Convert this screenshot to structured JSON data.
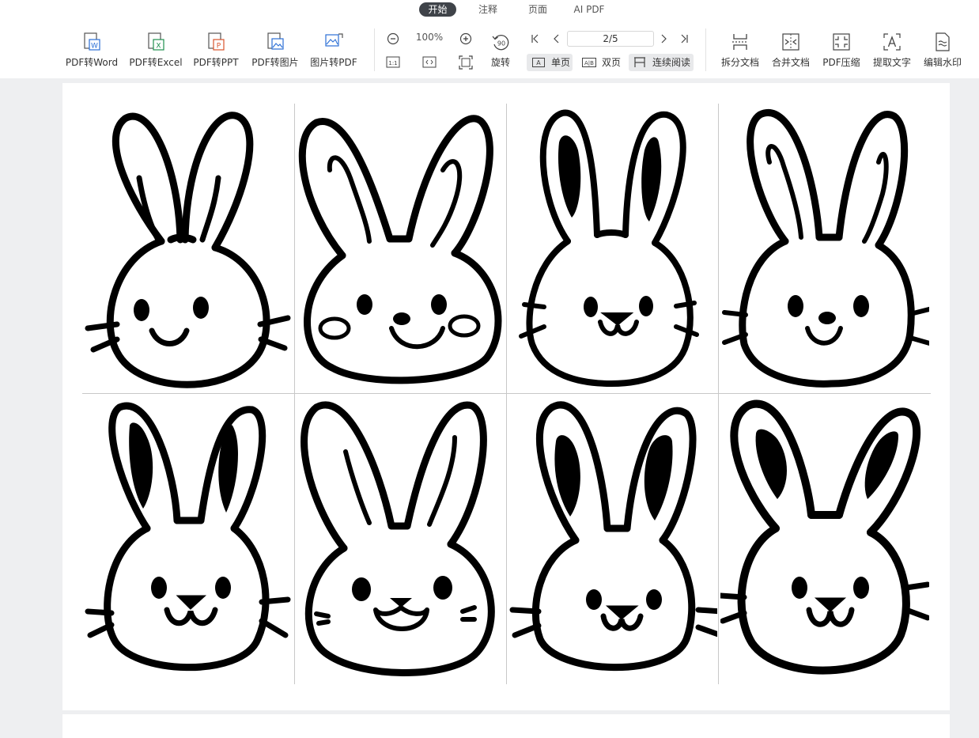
{
  "tabs": [
    "开始",
    "注释",
    "页面",
    "AI PDF"
  ],
  "toolbar": {
    "convert": [
      {
        "label": "PDF转Word",
        "badge": "W",
        "color": "#2b6fd6"
      },
      {
        "label": "PDF转Excel",
        "badge": "X",
        "color": "#1e8f4e"
      },
      {
        "label": "PDF转PPT",
        "badge": "P",
        "color": "#d9532c"
      },
      {
        "label": "PDF转图片",
        "color": "#2b6fd6"
      },
      {
        "label": "图片转PDF",
        "color": "#2b6fd6"
      }
    ],
    "zoom": "100%",
    "rotate_label": "旋转",
    "rotate_badge": "90",
    "page_indicator": "2/5",
    "single_page": "单页",
    "single_icon": "A",
    "double_page": "双页",
    "double_icon": "A|B",
    "continuous": "连续阅读",
    "fit_actual": "1:1",
    "tools": [
      "拆分文档",
      "合并文档",
      "PDF压缩",
      "提取文字",
      "编辑水印"
    ]
  }
}
